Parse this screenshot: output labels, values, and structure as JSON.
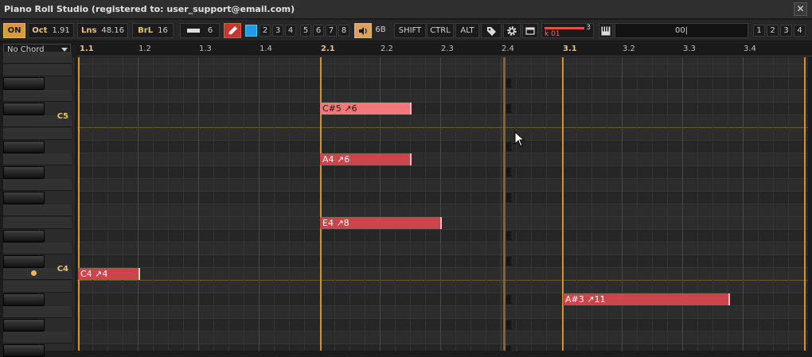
{
  "window": {
    "title": "Piano Roll Studio  (registered to: user_support@email.com)",
    "close_icon": "✕"
  },
  "toolbar": {
    "on_label": "ON",
    "oct_label": "Oct",
    "oct_value": "1.91",
    "lns_label": "Lns",
    "lns_value": "48.16",
    "brl_label": "BrL",
    "brl_value": "16",
    "note_length": "6",
    "snap_values": [
      "2",
      "3",
      "4",
      "5",
      "6",
      "7",
      "8"
    ],
    "volume_value": "6B",
    "shift_label": "SHIFT",
    "ctrl_label": "CTRL",
    "alt_label": "ALT",
    "channel_number": "3",
    "channel_label": "k 01",
    "pattern_value": "00|",
    "pattern_banks": [
      "1",
      "2",
      "3",
      "4"
    ]
  },
  "chord_select": {
    "selected": "No Chord"
  },
  "ruler": {
    "labels": [
      "1.1",
      "1.2",
      "1.3",
      "1.4",
      "2.1",
      "2.2",
      "2.3",
      "2.4",
      "3.1",
      "3.2",
      "3.3",
      "3.4"
    ]
  },
  "keyboard": {
    "labels": [
      "C5",
      "C4"
    ]
  },
  "notes": [
    {
      "label": "C#5 ↗6"
    },
    {
      "label": "A4 ↗6"
    },
    {
      "label": "E4 ↗8"
    },
    {
      "label": "C4 ↗4"
    },
    {
      "label": "A#3 ↗11"
    }
  ],
  "colors": {
    "accent": "#d89a3a",
    "note": "#c9474a",
    "note_selected": "#ef7a7a",
    "snap_active": "#1e9bea"
  }
}
